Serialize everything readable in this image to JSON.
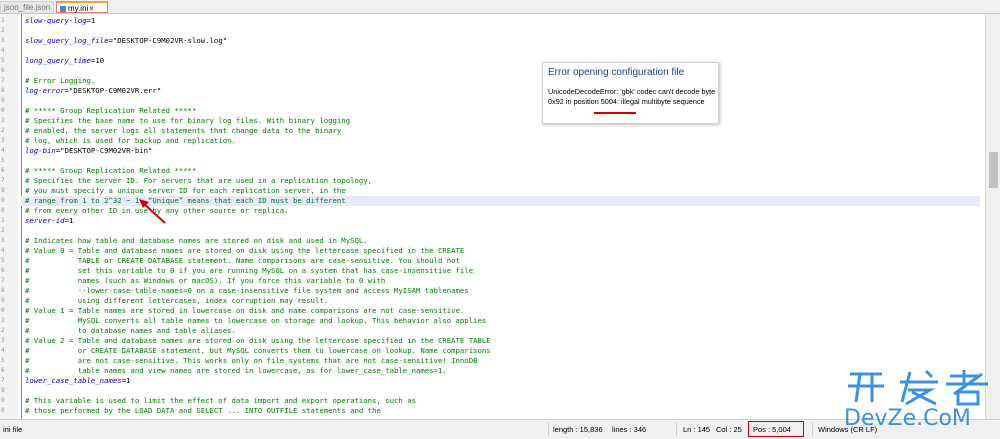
{
  "tabs": [
    {
      "label": "json_file.json"
    },
    {
      "label": "my.ini"
    }
  ],
  "line_numbers": [
    "1",
    "2",
    "3",
    "4",
    "5",
    "6",
    "7",
    "8",
    "9",
    "0",
    "1",
    "2",
    "3",
    "4",
    "5",
    "6",
    "7",
    "8",
    "9",
    "0",
    "1",
    "2",
    "3",
    "4",
    "5",
    "6",
    "7",
    "8",
    "9",
    "0",
    "1",
    "2",
    "3",
    "4",
    "5",
    "6",
    "7",
    "8",
    "9",
    "0"
  ],
  "lines": [
    {
      "type": "kv",
      "key": "slow-query-log",
      "value": "1"
    },
    {
      "type": "blank"
    },
    {
      "type": "kv",
      "key": "slow_query_log_file",
      "value": "\"DESKTOP-C9M02VR-slow.log\""
    },
    {
      "type": "blank"
    },
    {
      "type": "kv",
      "key": "long_query_time",
      "value": "10"
    },
    {
      "type": "blank"
    },
    {
      "type": "comment",
      "text": "# Error Logging."
    },
    {
      "type": "kv",
      "key": "log-error",
      "value": "\"DESKTOP-C9M02VR.err\""
    },
    {
      "type": "blank"
    },
    {
      "type": "comment",
      "text": "# ***** Group Replication Related *****"
    },
    {
      "type": "comment",
      "text": "# Specifies the base name to use for binary log files. With binary logging"
    },
    {
      "type": "comment",
      "text": "# enabled, the server logs all statements that change data to the binary"
    },
    {
      "type": "comment",
      "text": "# log, which is used for backup and replication."
    },
    {
      "type": "kv",
      "key": "log-bin",
      "value": "\"DESKTOP-C9M02VR-bin\""
    },
    {
      "type": "blank"
    },
    {
      "type": "comment",
      "text": "# ***** Group Replication Related *****"
    },
    {
      "type": "comment",
      "text": "# Specifies the server ID. For servers that are used in a replication topology,"
    },
    {
      "type": "comment",
      "text": "# you must specify a unique server ID for each replication server, in the"
    },
    {
      "type": "comment",
      "text": "# range from 1 to 2^32 − 1. “Unique” means that each ID must be different"
    },
    {
      "type": "comment",
      "text": "# from every other ID in use by any other source or replica."
    },
    {
      "type": "kv",
      "key": "server-id",
      "value": "1"
    },
    {
      "type": "blank"
    },
    {
      "type": "comment",
      "text": "# Indicates how table and database names are stored on disk and used in MySQL."
    },
    {
      "type": "comment",
      "text": "# Value 0 = Table and database names are stored on disk using the lettercase specified in the CREATE"
    },
    {
      "type": "comment",
      "text": "#           TABLE or CREATE DATABASE statement. Name comparisons are case-sensitive. You should not"
    },
    {
      "type": "comment",
      "text": "#           set this variable to 0 if you are running MySQL on a system that has case-insensitive file"
    },
    {
      "type": "comment",
      "text": "#           names (such as Windows or macOS). If you force this variable to 0 with"
    },
    {
      "type": "comment",
      "text": "#           --lower-case-table-names=0 on a case-insensitive file system and access MyISAM tablenames"
    },
    {
      "type": "comment",
      "text": "#           using different lettercases, index corruption may result."
    },
    {
      "type": "comment",
      "text": "# Value 1 = Table names are stored in lowercase on disk and name comparisons are not case-sensitive."
    },
    {
      "type": "comment",
      "text": "#           MySQL converts all table names to lowercase on storage and lookup. This behavior also applies"
    },
    {
      "type": "comment",
      "text": "#           to database names and table aliases."
    },
    {
      "type": "comment",
      "text": "# Value 2 = Table and database names are stored on disk using the lettercase specified in the CREATE TABLE"
    },
    {
      "type": "comment",
      "text": "#           or CREATE DATABASE statement, but MySQL converts them to lowercase on lookup. Name comparisons"
    },
    {
      "type": "comment",
      "text": "#           are not case-sensitive. This works only on file systems that are not case-sensitive! InnoDB"
    },
    {
      "type": "comment",
      "text": "#           table names and view names are stored in lowercase, as for lower_case_table_names=1."
    },
    {
      "type": "kv",
      "key": "lower_case_table_names",
      "value": "1"
    },
    {
      "type": "blank"
    },
    {
      "type": "comment",
      "text": "# This variable is used to limit the effect of data import and export operations, such as"
    },
    {
      "type": "comment",
      "text": "# those performed by the LOAD DATA and SELECT ... INTO OUTFILE statements and the"
    }
  ],
  "current_line_index": 18,
  "error_popup": {
    "title": "Error opening configuration file",
    "message": "UnicodeDecodeError: 'gbk' codec can't decode byte 0x92 in position 5004: illegal multibyte sequence"
  },
  "status": {
    "file_type": "ini file",
    "length": "length : 15,836",
    "lines": "lines : 346",
    "ln": "Ln : 145",
    "col": "Col : 25",
    "pos": "Pos : 5,004",
    "eol": "Windows (CR LF)"
  },
  "watermark": {
    "cn": "开发者",
    "en": "DevZe.CoM"
  },
  "colors": {
    "comment": "#008000",
    "key": "#0000e0",
    "popup_title": "#1f3e9c",
    "annotation_red": "#d00000",
    "watermark": "#1c7fd8"
  }
}
